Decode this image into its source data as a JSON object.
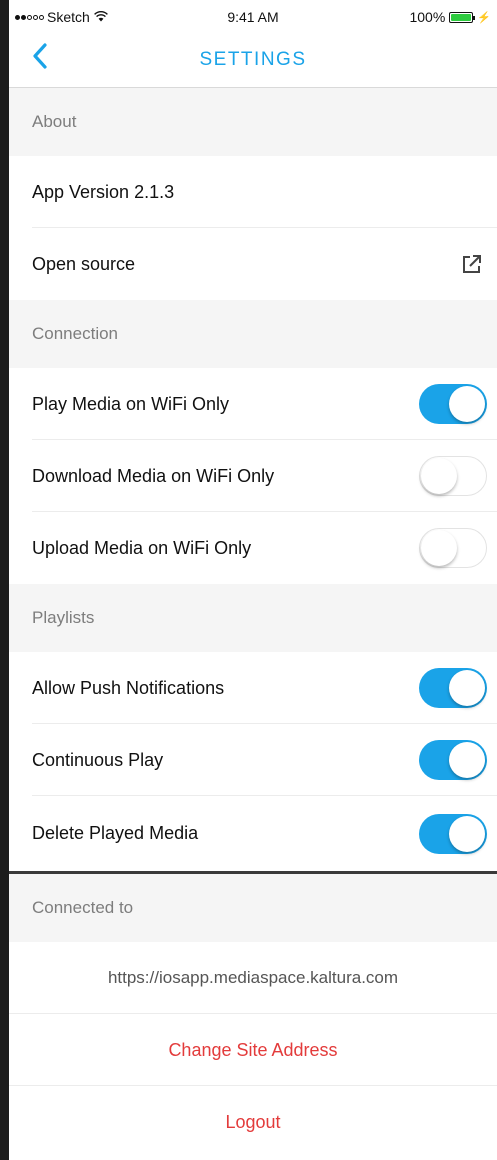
{
  "status_bar": {
    "carrier": "Sketch",
    "time": "9:41 AM",
    "battery": "100%",
    "icons": [
      "signal-dots-icon",
      "wifi-icon",
      "battery-icon",
      "charging-bolt-icon"
    ]
  },
  "nav": {
    "title": "SETTINGS",
    "back_icon": "chevron-left-icon"
  },
  "about": {
    "header": "About",
    "app_version": "App Version 2.1.3",
    "open_source": "Open source",
    "open_source_icon": "external-link-icon"
  },
  "connection": {
    "header": "Connection",
    "items": [
      {
        "label": "Play Media on WiFi Only",
        "on": true
      },
      {
        "label": "Download Media on WiFi Only",
        "on": false
      },
      {
        "label": "Upload Media on WiFi Only",
        "on": false
      }
    ]
  },
  "playlists": {
    "header": "Playlists",
    "items": [
      {
        "label": "Allow Push Notifications",
        "on": true
      },
      {
        "label": "Continuous Play",
        "on": true
      },
      {
        "label": "Delete Played Media",
        "on": true
      }
    ]
  },
  "connected_to": {
    "header": "Connected to",
    "url": "https://iosapp.mediaspace.kaltura.com",
    "change_site": "Change Site Address",
    "logout": "Logout"
  },
  "colors": {
    "accent": "#1aa3e8",
    "destructive": "#e33b3b",
    "section_bg": "#f5f5f5"
  }
}
